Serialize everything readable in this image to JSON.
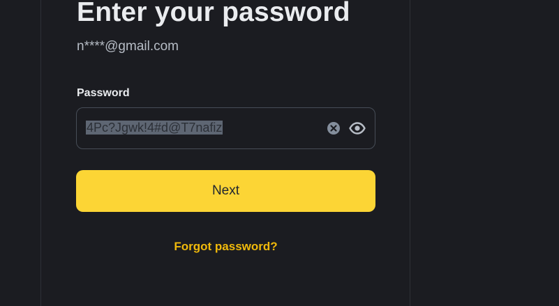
{
  "login": {
    "title": "Enter your password",
    "email_masked": "n****@gmail.com",
    "password_label": "Password",
    "password_value": "4Pc?Jgwk!4#d@T7nafiz",
    "next_label": "Next",
    "forgot_label": "Forgot password?"
  },
  "icons": {
    "clear": "clear-circle-x-icon",
    "visibility": "eye-icon"
  },
  "colors": {
    "background": "#1b1c21",
    "primary_button": "#fcd535",
    "link": "#f0b90b",
    "title_text": "#eaecef",
    "muted_text": "#b7bdc6",
    "border": "#474d57"
  }
}
